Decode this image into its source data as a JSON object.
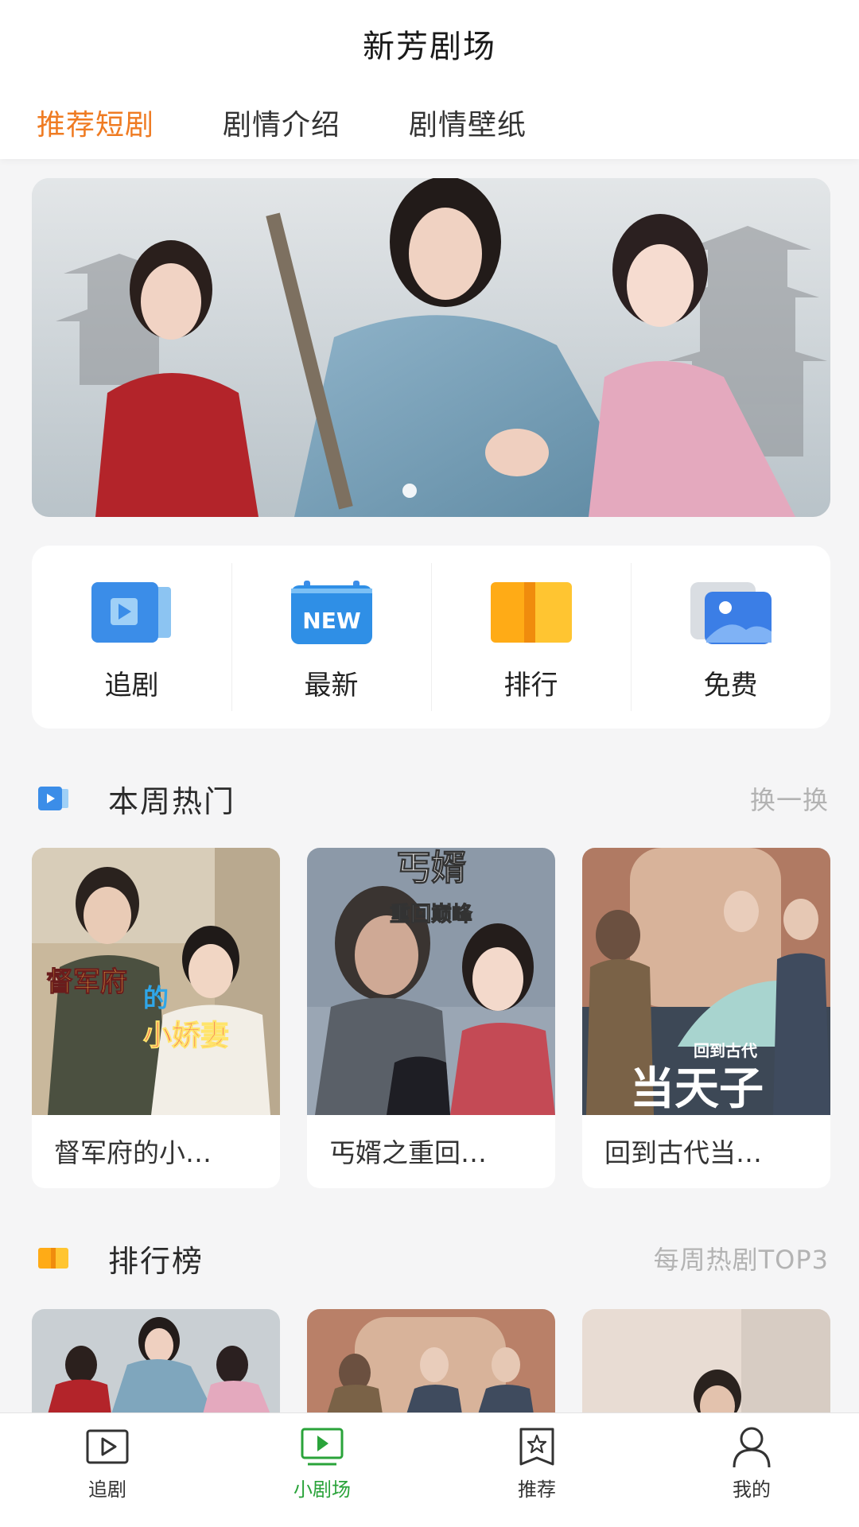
{
  "header": {
    "title": "新芳剧场",
    "tabs": [
      {
        "label": "推荐短剧",
        "active": true
      },
      {
        "label": "剧情介绍",
        "active": false
      },
      {
        "label": "剧情壁纸",
        "active": false
      }
    ]
  },
  "banner": {
    "slide_index": 1,
    "slide_count": 1
  },
  "quick_actions": [
    {
      "label": "追剧",
      "icon": "play-video-icon"
    },
    {
      "label": "最新",
      "icon": "new-calendar-icon"
    },
    {
      "label": "排行",
      "icon": "ranking-icon"
    },
    {
      "label": "免费",
      "icon": "gallery-icon"
    }
  ],
  "weekly_hot": {
    "title": "本周热门",
    "action": "换一换",
    "items": [
      {
        "title": "督军府的小…"
      },
      {
        "title": "丐婿之重回…"
      },
      {
        "title": "回到古代当…"
      }
    ]
  },
  "ranking": {
    "title": "排行榜",
    "subtitle": "每周热剧TOP3"
  },
  "bottom_nav": [
    {
      "label": "追剧",
      "icon": "play-box-icon",
      "active": false
    },
    {
      "label": "小剧场",
      "icon": "tv-icon",
      "active": true
    },
    {
      "label": "推荐",
      "icon": "star-bookmark-icon",
      "active": false
    },
    {
      "label": "我的",
      "icon": "user-icon",
      "active": false
    }
  ],
  "colors": {
    "accent": "#ef7b22",
    "nav_active": "#2aa33a",
    "blue_icon": "#3b8de8",
    "orange_icon": "#f5a623"
  }
}
